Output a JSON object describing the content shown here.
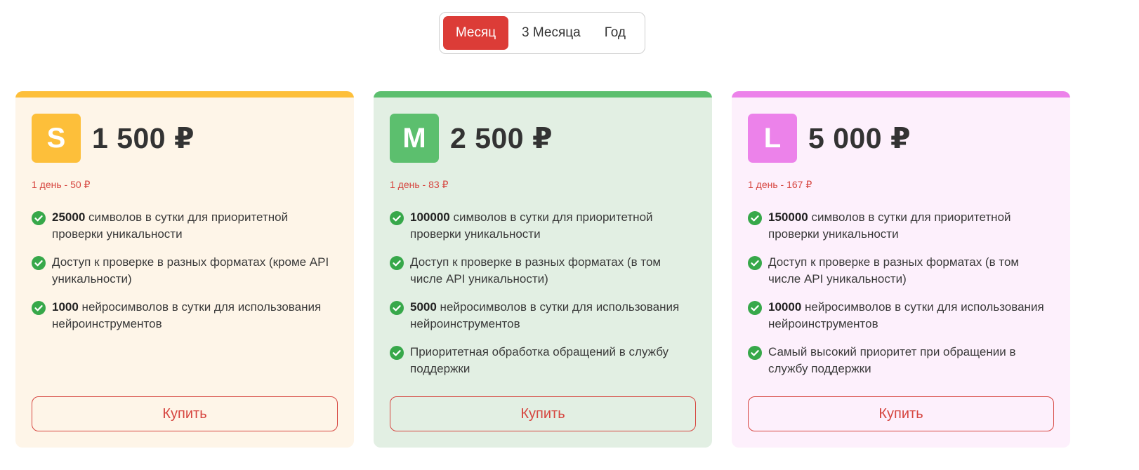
{
  "period_switch": {
    "options": [
      "Месяц",
      "3 Месяца",
      "Год"
    ],
    "selected": "Месяц"
  },
  "plans": [
    {
      "letter": "S",
      "price": "1 500 ₽",
      "per_day": "1 день - 50 ₽",
      "buy_label": "Купить",
      "accent_color": "#fdbf3a",
      "bg_color": "#fef5e8",
      "features": [
        {
          "bold": "25000",
          "text": " символов в сутки для приоритетной проверки уникальности"
        },
        {
          "bold": "",
          "text": "Доступ к проверке в разных форматах (кроме API уникальности)"
        },
        {
          "bold": "1000",
          "text": " нейросимволов в сутки для использования нейроинструментов"
        }
      ]
    },
    {
      "letter": "M",
      "price": "2 500 ₽",
      "per_day": "1 день - 83 ₽",
      "buy_label": "Купить",
      "accent_color": "#5cbf6e",
      "bg_color": "#e2efe3",
      "features": [
        {
          "bold": "100000",
          "text": " символов в сутки для приоритетной проверки уникальности"
        },
        {
          "bold": "",
          "text": "Доступ к проверке в разных форматах (в том числе API уникальности)"
        },
        {
          "bold": "5000",
          "text": " нейросимволов в сутки для использования нейроинструментов"
        },
        {
          "bold": "",
          "text": "Приоритетная обработка обращений в службу поддержки"
        }
      ]
    },
    {
      "letter": "L",
      "price": "5 000 ₽",
      "per_day": "1 день - 167 ₽",
      "buy_label": "Купить",
      "accent_color": "#ec82ea",
      "bg_color": "#fdf0fc",
      "features": [
        {
          "bold": "150000",
          "text": " символов в сутки для приоритетной проверки уникальности"
        },
        {
          "bold": "",
          "text": "Доступ к проверке в разных форматах (в том числе API уникальности)"
        },
        {
          "bold": "10000",
          "text": " нейросимволов в сутки для использования нейроинструментов"
        },
        {
          "bold": "",
          "text": "Самый высокий приоритет при обращении в службу поддержки"
        }
      ]
    }
  ],
  "colors": {
    "primary_red": "#dc3c37",
    "check_green": "#37a84a"
  },
  "icons": {
    "feature_marker": "check-circle-icon"
  }
}
